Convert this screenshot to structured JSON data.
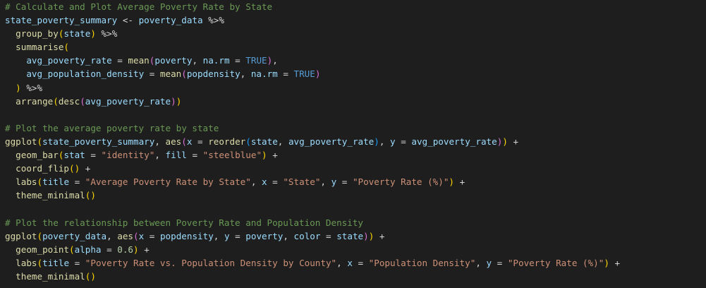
{
  "editor": {
    "lines": [
      [
        {
          "t": "# Calculate and Plot Average Poverty Rate by State",
          "c": "c"
        }
      ],
      [
        {
          "t": "state_poverty_summary",
          "c": "v"
        },
        {
          "t": " <- ",
          "c": "o"
        },
        {
          "t": "poverty_data",
          "c": "v"
        },
        {
          "t": " %>%",
          "c": "o"
        }
      ],
      [
        {
          "t": "  ",
          "c": "o"
        },
        {
          "t": "group_by",
          "c": "f"
        },
        {
          "t": "(",
          "c": "p"
        },
        {
          "t": "state",
          "c": "v"
        },
        {
          "t": ")",
          "c": "p"
        },
        {
          "t": " %>%",
          "c": "o"
        }
      ],
      [
        {
          "t": "  ",
          "c": "o"
        },
        {
          "t": "summarise",
          "c": "f"
        },
        {
          "t": "(",
          "c": "p"
        }
      ],
      [
        {
          "t": "    ",
          "c": "o"
        },
        {
          "t": "avg_poverty_rate",
          "c": "v"
        },
        {
          "t": " = ",
          "c": "o"
        },
        {
          "t": "mean",
          "c": "f"
        },
        {
          "t": "(",
          "c": "p2"
        },
        {
          "t": "poverty",
          "c": "v"
        },
        {
          "t": ", ",
          "c": "o"
        },
        {
          "t": "na.rm",
          "c": "v"
        },
        {
          "t": " = ",
          "c": "o"
        },
        {
          "t": "TRUE",
          "c": "k"
        },
        {
          "t": ")",
          "c": "p2"
        },
        {
          "t": ",",
          "c": "o"
        }
      ],
      [
        {
          "t": "    ",
          "c": "o"
        },
        {
          "t": "avg_population_density",
          "c": "v"
        },
        {
          "t": " = ",
          "c": "o"
        },
        {
          "t": "mean",
          "c": "f"
        },
        {
          "t": "(",
          "c": "p2"
        },
        {
          "t": "popdensity",
          "c": "v"
        },
        {
          "t": ", ",
          "c": "o"
        },
        {
          "t": "na.rm",
          "c": "v"
        },
        {
          "t": " = ",
          "c": "o"
        },
        {
          "t": "TRUE",
          "c": "k"
        },
        {
          "t": ")",
          "c": "p2"
        }
      ],
      [
        {
          "t": "  ",
          "c": "o"
        },
        {
          "t": ")",
          "c": "p"
        },
        {
          "t": " %>%",
          "c": "o"
        }
      ],
      [
        {
          "t": "  ",
          "c": "o"
        },
        {
          "t": "arrange",
          "c": "f"
        },
        {
          "t": "(",
          "c": "p"
        },
        {
          "t": "desc",
          "c": "f"
        },
        {
          "t": "(",
          "c": "p2"
        },
        {
          "t": "avg_poverty_rate",
          "c": "v"
        },
        {
          "t": ")",
          "c": "p2"
        },
        {
          "t": ")",
          "c": "p"
        }
      ],
      [
        {
          "t": "",
          "c": "o"
        }
      ],
      [
        {
          "t": "# Plot the average poverty rate by state",
          "c": "c"
        }
      ],
      [
        {
          "t": "ggplot",
          "c": "f"
        },
        {
          "t": "(",
          "c": "p"
        },
        {
          "t": "state_poverty_summary",
          "c": "v"
        },
        {
          "t": ", ",
          "c": "o"
        },
        {
          "t": "aes",
          "c": "f"
        },
        {
          "t": "(",
          "c": "p2"
        },
        {
          "t": "x",
          "c": "v"
        },
        {
          "t": " = ",
          "c": "o"
        },
        {
          "t": "reorder",
          "c": "f"
        },
        {
          "t": "(",
          "c": "p3"
        },
        {
          "t": "state",
          "c": "v"
        },
        {
          "t": ", ",
          "c": "o"
        },
        {
          "t": "avg_poverty_rate",
          "c": "v"
        },
        {
          "t": ")",
          "c": "p3"
        },
        {
          "t": ", ",
          "c": "o"
        },
        {
          "t": "y",
          "c": "v"
        },
        {
          "t": " = ",
          "c": "o"
        },
        {
          "t": "avg_poverty_rate",
          "c": "v"
        },
        {
          "t": ")",
          "c": "p2"
        },
        {
          "t": ")",
          "c": "p"
        },
        {
          "t": " +",
          "c": "o"
        }
      ],
      [
        {
          "t": "  ",
          "c": "o"
        },
        {
          "t": "geom_bar",
          "c": "f"
        },
        {
          "t": "(",
          "c": "p"
        },
        {
          "t": "stat",
          "c": "v"
        },
        {
          "t": " = ",
          "c": "o"
        },
        {
          "t": "\"identity\"",
          "c": "s"
        },
        {
          "t": ", ",
          "c": "o"
        },
        {
          "t": "fill",
          "c": "v"
        },
        {
          "t": " = ",
          "c": "o"
        },
        {
          "t": "\"steelblue\"",
          "c": "s"
        },
        {
          "t": ")",
          "c": "p"
        },
        {
          "t": " +",
          "c": "o"
        }
      ],
      [
        {
          "t": "  ",
          "c": "o"
        },
        {
          "t": "coord_flip",
          "c": "f"
        },
        {
          "t": "(",
          "c": "p"
        },
        {
          "t": ")",
          "c": "p"
        },
        {
          "t": " +",
          "c": "o"
        }
      ],
      [
        {
          "t": "  ",
          "c": "o"
        },
        {
          "t": "labs",
          "c": "f"
        },
        {
          "t": "(",
          "c": "p"
        },
        {
          "t": "title",
          "c": "v"
        },
        {
          "t": " = ",
          "c": "o"
        },
        {
          "t": "\"Average Poverty Rate by State\"",
          "c": "s"
        },
        {
          "t": ", ",
          "c": "o"
        },
        {
          "t": "x",
          "c": "v"
        },
        {
          "t": " = ",
          "c": "o"
        },
        {
          "t": "\"State\"",
          "c": "s"
        },
        {
          "t": ", ",
          "c": "o"
        },
        {
          "t": "y",
          "c": "v"
        },
        {
          "t": " = ",
          "c": "o"
        },
        {
          "t": "\"Poverty Rate (%)\"",
          "c": "s"
        },
        {
          "t": ")",
          "c": "p"
        },
        {
          "t": " +",
          "c": "o"
        }
      ],
      [
        {
          "t": "  ",
          "c": "o"
        },
        {
          "t": "theme_minimal",
          "c": "f"
        },
        {
          "t": "(",
          "c": "p"
        },
        {
          "t": ")",
          "c": "p"
        }
      ],
      [
        {
          "t": "",
          "c": "o"
        }
      ],
      [
        {
          "t": "# Plot the relationship between Poverty Rate and Population Density",
          "c": "c"
        }
      ],
      [
        {
          "t": "ggplot",
          "c": "f"
        },
        {
          "t": "(",
          "c": "p"
        },
        {
          "t": "poverty_data",
          "c": "v"
        },
        {
          "t": ", ",
          "c": "o"
        },
        {
          "t": "aes",
          "c": "f"
        },
        {
          "t": "(",
          "c": "p2"
        },
        {
          "t": "x",
          "c": "v"
        },
        {
          "t": " = ",
          "c": "o"
        },
        {
          "t": "popdensity",
          "c": "v"
        },
        {
          "t": ", ",
          "c": "o"
        },
        {
          "t": "y",
          "c": "v"
        },
        {
          "t": " = ",
          "c": "o"
        },
        {
          "t": "poverty",
          "c": "v"
        },
        {
          "t": ", ",
          "c": "o"
        },
        {
          "t": "color",
          "c": "v"
        },
        {
          "t": " = ",
          "c": "o"
        },
        {
          "t": "state",
          "c": "v"
        },
        {
          "t": ")",
          "c": "p2"
        },
        {
          "t": ")",
          "c": "p"
        },
        {
          "t": " +",
          "c": "o"
        }
      ],
      [
        {
          "t": "  ",
          "c": "o"
        },
        {
          "t": "geom_point",
          "c": "f"
        },
        {
          "t": "(",
          "c": "p"
        },
        {
          "t": "alpha",
          "c": "v"
        },
        {
          "t": " = ",
          "c": "o"
        },
        {
          "t": "0.6",
          "c": "n"
        },
        {
          "t": ")",
          "c": "p"
        },
        {
          "t": " +",
          "c": "o"
        }
      ],
      [
        {
          "t": "  ",
          "c": "o"
        },
        {
          "t": "labs",
          "c": "f"
        },
        {
          "t": "(",
          "c": "p"
        },
        {
          "t": "title",
          "c": "v"
        },
        {
          "t": " = ",
          "c": "o"
        },
        {
          "t": "\"Poverty Rate vs. Population Density by County\"",
          "c": "s"
        },
        {
          "t": ", ",
          "c": "o"
        },
        {
          "t": "x",
          "c": "v"
        },
        {
          "t": " = ",
          "c": "o"
        },
        {
          "t": "\"Population Density\"",
          "c": "s"
        },
        {
          "t": ", ",
          "c": "o"
        },
        {
          "t": "y",
          "c": "v"
        },
        {
          "t": " = ",
          "c": "o"
        },
        {
          "t": "\"Poverty Rate (%)\"",
          "c": "s"
        },
        {
          "t": ")",
          "c": "p"
        },
        {
          "t": " +",
          "c": "o"
        }
      ],
      [
        {
          "t": "  ",
          "c": "o"
        },
        {
          "t": "theme_minimal",
          "c": "f"
        },
        {
          "t": "(",
          "c": "p"
        },
        {
          "t": ")",
          "c": "p"
        }
      ]
    ]
  },
  "colors": {
    "background": "#1e1e1e",
    "comment": "#6a9955",
    "variable": "#9cdcfe",
    "function": "#dcdcaa",
    "string": "#ce9178",
    "keyword": "#569cd6",
    "number": "#b5cea8",
    "operator": "#d4d4d4"
  }
}
